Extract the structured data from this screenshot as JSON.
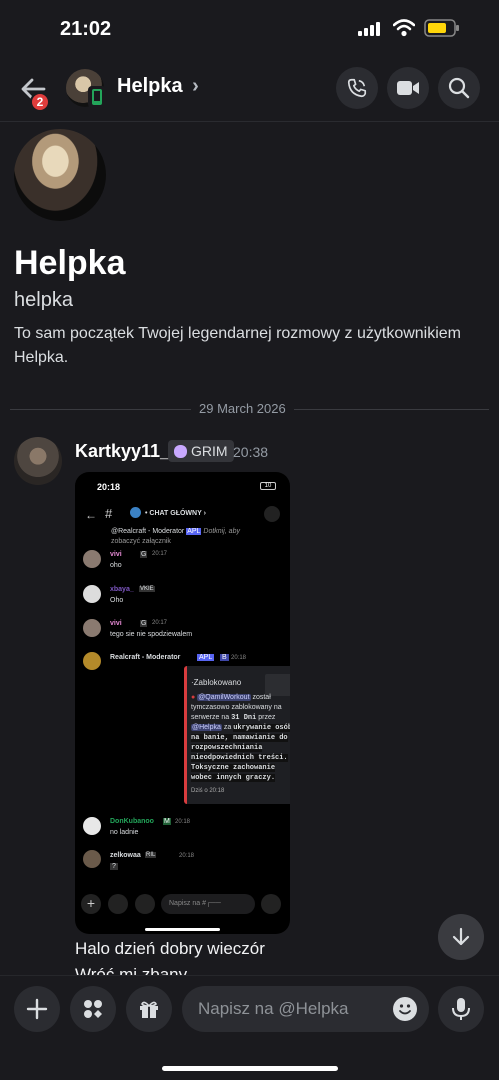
{
  "status_bar": {
    "time": "21:02"
  },
  "header": {
    "badge": "2",
    "name": "Helpka",
    "chevron": "›"
  },
  "intro": {
    "name": "Helpka",
    "username": "helpka",
    "description": "To sam początek Twojej legendarnej rozmowy z użytkownikiem Helpka."
  },
  "date_divider": "29 March 2026",
  "message": {
    "author": "Kartkyy11_",
    "tag": "GRIM",
    "time": "20:38",
    "lines": [
      "Halo dzień dobry wieczór",
      "Wróć mi zbany"
    ]
  },
  "screenshot": {
    "time": "20:18",
    "battery": "10",
    "channel": "• CHAT GŁÓWNY ›",
    "reply_author": "@Realcraft - Moderator",
    "reply_badge": "APL",
    "reply_hint": "Dotknij, aby",
    "reply_hint2": "zobaczyć załącznik",
    "msgs": [
      {
        "author": "vivi",
        "badge": "G",
        "time": "20:17",
        "text": "oho"
      },
      {
        "author": "xbaya_",
        "badge": "VKIE",
        "time": "",
        "text": "Oho"
      },
      {
        "author": "vivi",
        "badge": "G",
        "time": "20:17",
        "text": "tego sie nie spodziewalem"
      }
    ],
    "mod_author": "Realcraft - Moderator",
    "mod_badge": "APL",
    "mod_badge2": "B",
    "mod_time": "20:18",
    "embed_title": "·Zablokowano",
    "embed_line1": "@QamilWorkout",
    "embed_line1b": "został",
    "embed_line2": "tymczasowo zablokowany na",
    "embed_line3a": "serwerze na",
    "embed_line3b": "31 Dni",
    "embed_line3c": "przez",
    "embed_line4a": "@Helpka",
    "embed_line4b": "za",
    "embed_line4c": "ukrywanie osób",
    "embed_mono": [
      "na banie, namawianie do",
      "rozpowszechniania",
      "nieodpowiednich treści.",
      "Toksyczne zachowanie",
      "wobec innych graczy."
    ],
    "embed_footer": "Dziś o 20:18",
    "msgs2": [
      {
        "author": "DonKubanoo",
        "badge": "M",
        "time": "20:18",
        "text": "no ladnie"
      },
      {
        "author": "zelkowaa",
        "badge": "RIL",
        "time": "20:18",
        "text": "?"
      }
    ],
    "composer_placeholder": "Napisz na #┌──"
  },
  "composer": {
    "placeholder": "Napisz na @Helpka"
  },
  "colors": {
    "bg": "#1a1a1e",
    "accent": "#5865f2",
    "badge": "#e03c3c",
    "embed_bar": "#d83c3e"
  }
}
